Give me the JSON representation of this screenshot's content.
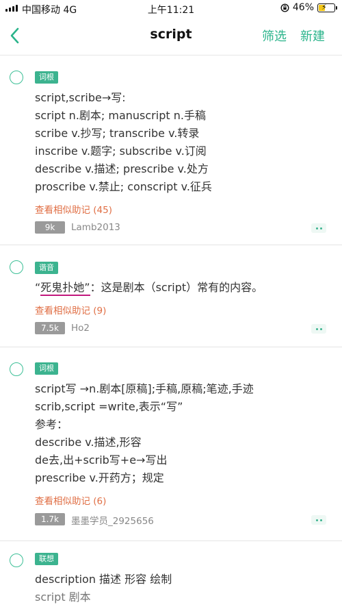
{
  "status_bar": {
    "carrier": "中国移动  4G",
    "time": "上午11:21",
    "battery_percent": "46%",
    "battery_level": 0.46,
    "icons": [
      "signal-icon",
      "orientation-lock-icon",
      "battery-icon",
      "charging-bolt-icon"
    ]
  },
  "nav": {
    "title": "script",
    "filter_label": "筛选",
    "new_label": "新建",
    "back_icon": "chevron-left-icon"
  },
  "colors": {
    "accent": "#2bb48b",
    "tag_bg": "#3cb38f",
    "link": "#e06f45",
    "badge_bg": "#9a9a9a",
    "underline": "#c2177c"
  },
  "cards": [
    {
      "tag": "词根",
      "lines": [
        "script,scribe→写:",
        "script  n.剧本; manuscript n.手稿",
        "scribe  v.抄写;  transcribe  v.转录",
        "inscribe  v.题字; subscribe  v.订阅",
        "describe v.描述;  prescribe  v.处方",
        "proscribe v.禁止; conscript  v.征兵"
      ],
      "similar": "查看相似助记 (45)",
      "count": "9k",
      "author": "Lamb2013"
    },
    {
      "tag": "谐音",
      "line_prefix": "“",
      "line_highlight": "死鬼扑她”",
      "line_rest": "：这是剧本（script）常有的内容。",
      "similar": "查看相似助记 (9)",
      "count": "7.5k",
      "author": "Ho2"
    },
    {
      "tag": "词根",
      "lines": [
        "script写 →n.剧本[原稿];手稿,原稿;笔迹,手迹",
        "scrib,script =write,表示“写”",
        "参考：",
        "describe  v.描述,形容",
        "de去,出+scrib写+e→写出",
        "prescribe  v.开药方；规定"
      ],
      "similar": "查看相似助记 (6)",
      "count": "1.7k",
      "author": "墨墨学员_2925656"
    },
    {
      "tag": "联想",
      "lines": [
        "description 描述 形容 绘制",
        "script 剧本"
      ]
    }
  ]
}
